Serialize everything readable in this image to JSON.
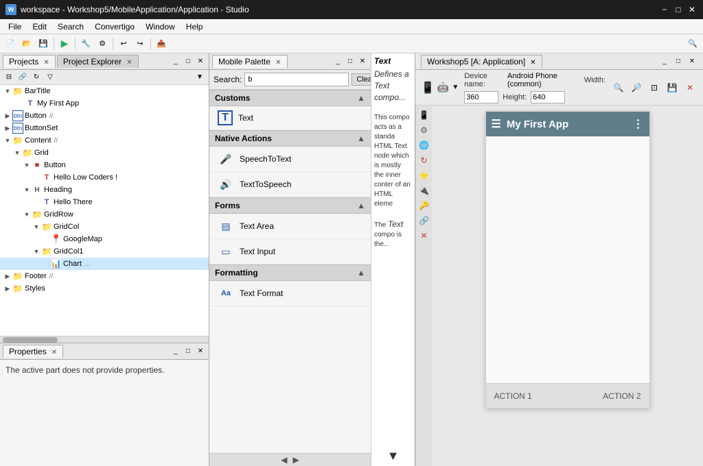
{
  "titleBar": {
    "title": "workspace - Workshop5/MobileApplication/Application - Studio",
    "icon": "W"
  },
  "menuBar": {
    "items": [
      "File",
      "Edit",
      "Search",
      "Convertigo",
      "Window",
      "Help"
    ]
  },
  "leftPanel": {
    "tabs": [
      {
        "label": "Projects",
        "active": true
      },
      {
        "label": "Project Explorer",
        "active": false
      }
    ],
    "tree": [
      {
        "indent": 0,
        "arrow": "▼",
        "icon": "folder",
        "label": "BarTitle",
        "badge": ""
      },
      {
        "indent": 1,
        "arrow": "",
        "icon": "t",
        "label": "My First App",
        "badge": ""
      },
      {
        "indent": 0,
        "arrow": "▶",
        "icon": "btn",
        "label": "Button",
        "badge": "//"
      },
      {
        "indent": 0,
        "arrow": "▶",
        "icon": "btn",
        "label": "ButtonSet",
        "badge": ""
      },
      {
        "indent": 0,
        "arrow": "▼",
        "icon": "folder",
        "label": "Content",
        "badge": "//"
      },
      {
        "indent": 1,
        "arrow": "▼",
        "icon": "folder",
        "label": "Grid",
        "badge": ""
      },
      {
        "indent": 2,
        "arrow": "",
        "icon": "btn-red",
        "label": "Button",
        "badge": ""
      },
      {
        "indent": 3,
        "arrow": "",
        "icon": "t-red",
        "label": "Hello Low Coders !",
        "badge": ""
      },
      {
        "indent": 2,
        "arrow": "▼",
        "icon": "heading",
        "label": "Heading",
        "badge": ""
      },
      {
        "indent": 3,
        "arrow": "",
        "icon": "t",
        "label": "Hello There",
        "badge": ""
      },
      {
        "indent": 2,
        "arrow": "▼",
        "icon": "folder",
        "label": "GridRow",
        "badge": ""
      },
      {
        "indent": 3,
        "arrow": "▼",
        "icon": "folder",
        "label": "GridCol",
        "badge": ""
      },
      {
        "indent": 4,
        "arrow": "",
        "icon": "map-red",
        "label": "GoogleMap",
        "badge": ""
      },
      {
        "indent": 3,
        "arrow": "▼",
        "icon": "folder",
        "label": "GridCol1",
        "badge": ""
      },
      {
        "indent": 4,
        "arrow": "",
        "icon": "chart",
        "label": "Chart",
        "badge": "..."
      },
      {
        "indent": 0,
        "arrow": "▶",
        "icon": "folder",
        "label": "Footer",
        "badge": "//"
      },
      {
        "indent": 0,
        "arrow": "▶",
        "icon": "folder",
        "label": "Styles",
        "badge": ""
      }
    ]
  },
  "propertiesPanel": {
    "title": "Properties",
    "message": "The active part does not provide properties."
  },
  "mobilepalette": {
    "title": "Mobile Palette",
    "searchPlaceholder": "b",
    "clearButton": "Clear",
    "sections": [
      {
        "label": "Customs",
        "items": [
          {
            "icon": "T",
            "label": "Text"
          }
        ]
      },
      {
        "label": "Native Actions",
        "items": [
          {
            "icon": "mic",
            "label": "SpeechToText"
          },
          {
            "icon": "speech",
            "label": "TextToSpeech"
          }
        ]
      },
      {
        "label": "Forms",
        "items": [
          {
            "icon": "textarea",
            "label": "Text Area"
          },
          {
            "icon": "textinput",
            "label": "Text Input"
          }
        ]
      },
      {
        "label": "Formatting",
        "items": [
          {
            "icon": "Aa",
            "label": "Text Format"
          }
        ]
      }
    ]
  },
  "descPanel": {
    "title": "Text",
    "text": "Defines a Text compo... This compo acts as a standa HTML Text node which is mostly the inner conter of an HTML eleme The Text compo is the..."
  },
  "previewPanel": {
    "title": "Workshop5 [A: Application]",
    "deviceLabel": "Device name:",
    "deviceName": "Android Phone (common)",
    "widthLabel": "Width:",
    "width": "360",
    "heightLabel": "Height:",
    "height": "640",
    "phone": {
      "appName": "My First App",
      "action1": "ACTION 1",
      "action2": "ACTION 2"
    }
  }
}
